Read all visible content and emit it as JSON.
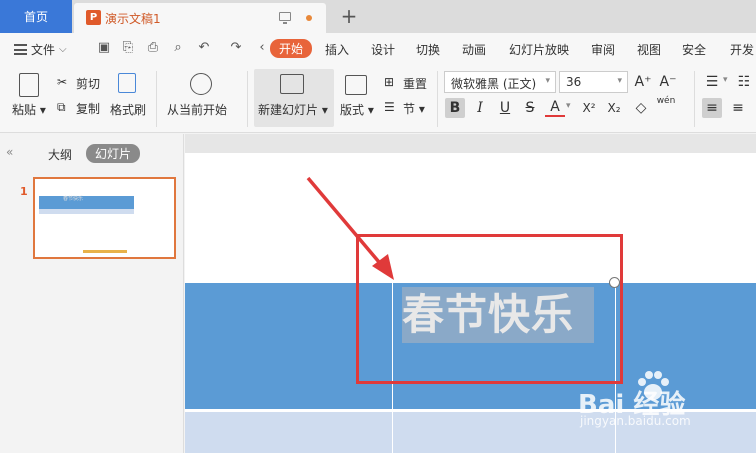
{
  "tabs": {
    "home": "首页",
    "doc_title": "演示文稿1",
    "doc_icon": "P",
    "add": "+"
  },
  "menu": {
    "file": "文件",
    "items": [
      "开始",
      "插入",
      "设计",
      "切换",
      "动画",
      "幻灯片放映",
      "审阅",
      "视图",
      "安全",
      "开发"
    ]
  },
  "ribbon": {
    "paste": "粘贴",
    "cut": "剪切",
    "copy": "复制",
    "format_painter": "格式刷",
    "from_current": "从当前开始",
    "new_slide": "新建幻灯片",
    "layout": "版式",
    "reset": "重置",
    "section": "节",
    "font_name": "微软雅黑 (正文)",
    "font_size": "36",
    "increase_font": "A⁺",
    "decrease_font": "A⁻",
    "bold": "B",
    "italic": "I",
    "underline": "U",
    "strikethrough": "S",
    "font_color": "A",
    "superscript": "X²",
    "subscript": "X₂",
    "eraser": "◇",
    "phonetic": "wén"
  },
  "panel": {
    "outline_tab": "大纲",
    "slides_tab": "幻灯片",
    "slide_number": "1"
  },
  "slide": {
    "heading": "春节快乐"
  },
  "watermark": {
    "logo": "Bai  经验",
    "url": "jingyan.baidu.com"
  },
  "colors": {
    "accent": "#e8643a",
    "home_tab": "#3a78d8",
    "band": "#5b9bd5",
    "annotation": "#e03a3a"
  }
}
